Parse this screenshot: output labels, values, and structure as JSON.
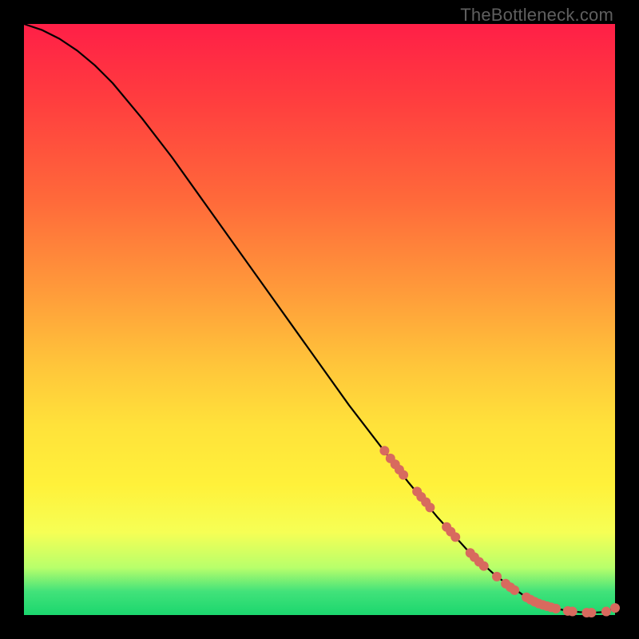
{
  "watermark": "TheBottleneck.com",
  "chart_data": {
    "type": "line",
    "title": "",
    "xlabel": "",
    "ylabel": "",
    "xlim": [
      0,
      100
    ],
    "ylim": [
      0,
      100
    ],
    "series": [
      {
        "name": "curve",
        "x": [
          0,
          3,
          6,
          9,
          12,
          15,
          20,
          25,
          30,
          35,
          40,
          45,
          50,
          55,
          60,
          65,
          70,
          75,
          80,
          85,
          88,
          90,
          92,
          94,
          96,
          98,
          100
        ],
        "y": [
          100,
          99,
          97.5,
          95.5,
          93,
          90,
          84,
          77.5,
          70.5,
          63.5,
          56.5,
          49.5,
          42.5,
          35.5,
          29,
          22.5,
          16.5,
          11,
          6.5,
          3,
          1.7,
          1.1,
          0.7,
          0.5,
          0.4,
          0.5,
          1.2
        ]
      }
    ],
    "markers": [
      {
        "x": 61,
        "y": 27.8
      },
      {
        "x": 62,
        "y": 26.5
      },
      {
        "x": 62.8,
        "y": 25.5
      },
      {
        "x": 63.5,
        "y": 24.6
      },
      {
        "x": 64.2,
        "y": 23.7
      },
      {
        "x": 66.5,
        "y": 20.9
      },
      {
        "x": 67.2,
        "y": 20.0
      },
      {
        "x": 68,
        "y": 19.1
      },
      {
        "x": 68.7,
        "y": 18.2
      },
      {
        "x": 71.5,
        "y": 14.9
      },
      {
        "x": 72.2,
        "y": 14.1
      },
      {
        "x": 73,
        "y": 13.2
      },
      {
        "x": 75.5,
        "y": 10.5
      },
      {
        "x": 76.2,
        "y": 9.8
      },
      {
        "x": 77,
        "y": 9.0
      },
      {
        "x": 77.8,
        "y": 8.3
      },
      {
        "x": 80,
        "y": 6.5
      },
      {
        "x": 81.5,
        "y": 5.3
      },
      {
        "x": 82.3,
        "y": 4.7
      },
      {
        "x": 83,
        "y": 4.2
      },
      {
        "x": 85,
        "y": 3.0
      },
      {
        "x": 85.7,
        "y": 2.6
      },
      {
        "x": 86.4,
        "y": 2.25
      },
      {
        "x": 87.1,
        "y": 1.95
      },
      {
        "x": 87.8,
        "y": 1.7
      },
      {
        "x": 88.5,
        "y": 1.5
      },
      {
        "x": 89.2,
        "y": 1.3
      },
      {
        "x": 90,
        "y": 1.1
      },
      {
        "x": 92,
        "y": 0.7
      },
      {
        "x": 92.8,
        "y": 0.6
      },
      {
        "x": 95.2,
        "y": 0.4
      },
      {
        "x": 96,
        "y": 0.4
      },
      {
        "x": 98.5,
        "y": 0.6
      },
      {
        "x": 100,
        "y": 1.2
      }
    ],
    "marker_style": {
      "color": "#d86a5e",
      "radius_px": 6
    }
  }
}
